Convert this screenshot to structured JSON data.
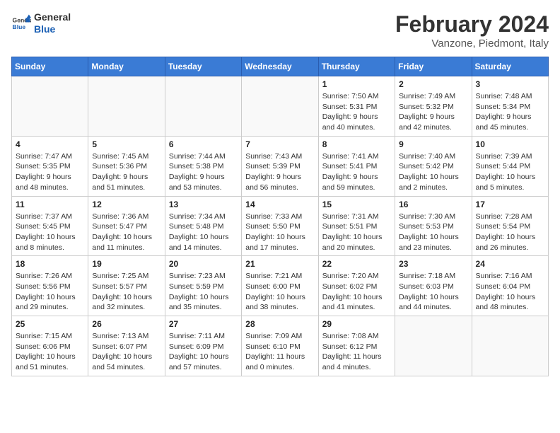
{
  "header": {
    "logo_line1": "General",
    "logo_line2": "Blue",
    "month_title": "February 2024",
    "subtitle": "Vanzone, Piedmont, Italy"
  },
  "days_of_week": [
    "Sunday",
    "Monday",
    "Tuesday",
    "Wednesday",
    "Thursday",
    "Friday",
    "Saturday"
  ],
  "weeks": [
    [
      {
        "day": "",
        "info": ""
      },
      {
        "day": "",
        "info": ""
      },
      {
        "day": "",
        "info": ""
      },
      {
        "day": "",
        "info": ""
      },
      {
        "day": "1",
        "info": "Sunrise: 7:50 AM\nSunset: 5:31 PM\nDaylight: 9 hours\nand 40 minutes."
      },
      {
        "day": "2",
        "info": "Sunrise: 7:49 AM\nSunset: 5:32 PM\nDaylight: 9 hours\nand 42 minutes."
      },
      {
        "day": "3",
        "info": "Sunrise: 7:48 AM\nSunset: 5:34 PM\nDaylight: 9 hours\nand 45 minutes."
      }
    ],
    [
      {
        "day": "4",
        "info": "Sunrise: 7:47 AM\nSunset: 5:35 PM\nDaylight: 9 hours\nand 48 minutes."
      },
      {
        "day": "5",
        "info": "Sunrise: 7:45 AM\nSunset: 5:36 PM\nDaylight: 9 hours\nand 51 minutes."
      },
      {
        "day": "6",
        "info": "Sunrise: 7:44 AM\nSunset: 5:38 PM\nDaylight: 9 hours\nand 53 minutes."
      },
      {
        "day": "7",
        "info": "Sunrise: 7:43 AM\nSunset: 5:39 PM\nDaylight: 9 hours\nand 56 minutes."
      },
      {
        "day": "8",
        "info": "Sunrise: 7:41 AM\nSunset: 5:41 PM\nDaylight: 9 hours\nand 59 minutes."
      },
      {
        "day": "9",
        "info": "Sunrise: 7:40 AM\nSunset: 5:42 PM\nDaylight: 10 hours\nand 2 minutes."
      },
      {
        "day": "10",
        "info": "Sunrise: 7:39 AM\nSunset: 5:44 PM\nDaylight: 10 hours\nand 5 minutes."
      }
    ],
    [
      {
        "day": "11",
        "info": "Sunrise: 7:37 AM\nSunset: 5:45 PM\nDaylight: 10 hours\nand 8 minutes."
      },
      {
        "day": "12",
        "info": "Sunrise: 7:36 AM\nSunset: 5:47 PM\nDaylight: 10 hours\nand 11 minutes."
      },
      {
        "day": "13",
        "info": "Sunrise: 7:34 AM\nSunset: 5:48 PM\nDaylight: 10 hours\nand 14 minutes."
      },
      {
        "day": "14",
        "info": "Sunrise: 7:33 AM\nSunset: 5:50 PM\nDaylight: 10 hours\nand 17 minutes."
      },
      {
        "day": "15",
        "info": "Sunrise: 7:31 AM\nSunset: 5:51 PM\nDaylight: 10 hours\nand 20 minutes."
      },
      {
        "day": "16",
        "info": "Sunrise: 7:30 AM\nSunset: 5:53 PM\nDaylight: 10 hours\nand 23 minutes."
      },
      {
        "day": "17",
        "info": "Sunrise: 7:28 AM\nSunset: 5:54 PM\nDaylight: 10 hours\nand 26 minutes."
      }
    ],
    [
      {
        "day": "18",
        "info": "Sunrise: 7:26 AM\nSunset: 5:56 PM\nDaylight: 10 hours\nand 29 minutes."
      },
      {
        "day": "19",
        "info": "Sunrise: 7:25 AM\nSunset: 5:57 PM\nDaylight: 10 hours\nand 32 minutes."
      },
      {
        "day": "20",
        "info": "Sunrise: 7:23 AM\nSunset: 5:59 PM\nDaylight: 10 hours\nand 35 minutes."
      },
      {
        "day": "21",
        "info": "Sunrise: 7:21 AM\nSunset: 6:00 PM\nDaylight: 10 hours\nand 38 minutes."
      },
      {
        "day": "22",
        "info": "Sunrise: 7:20 AM\nSunset: 6:02 PM\nDaylight: 10 hours\nand 41 minutes."
      },
      {
        "day": "23",
        "info": "Sunrise: 7:18 AM\nSunset: 6:03 PM\nDaylight: 10 hours\nand 44 minutes."
      },
      {
        "day": "24",
        "info": "Sunrise: 7:16 AM\nSunset: 6:04 PM\nDaylight: 10 hours\nand 48 minutes."
      }
    ],
    [
      {
        "day": "25",
        "info": "Sunrise: 7:15 AM\nSunset: 6:06 PM\nDaylight: 10 hours\nand 51 minutes."
      },
      {
        "day": "26",
        "info": "Sunrise: 7:13 AM\nSunset: 6:07 PM\nDaylight: 10 hours\nand 54 minutes."
      },
      {
        "day": "27",
        "info": "Sunrise: 7:11 AM\nSunset: 6:09 PM\nDaylight: 10 hours\nand 57 minutes."
      },
      {
        "day": "28",
        "info": "Sunrise: 7:09 AM\nSunset: 6:10 PM\nDaylight: 11 hours\nand 0 minutes."
      },
      {
        "day": "29",
        "info": "Sunrise: 7:08 AM\nSunset: 6:12 PM\nDaylight: 11 hours\nand 4 minutes."
      },
      {
        "day": "",
        "info": ""
      },
      {
        "day": "",
        "info": ""
      }
    ]
  ]
}
